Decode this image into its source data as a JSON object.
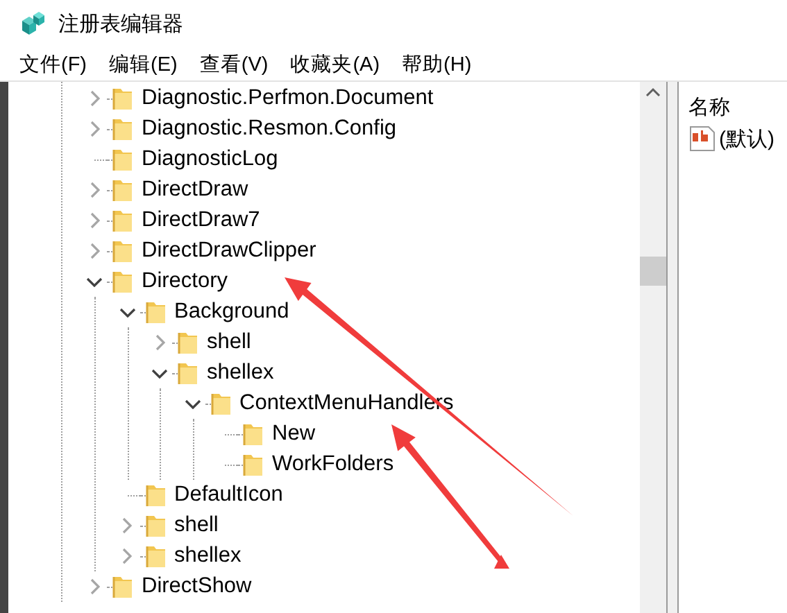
{
  "window": {
    "title": "注册表编辑器"
  },
  "menu": [
    "文件(F)",
    "编辑(E)",
    "查看(V)",
    "收藏夹(A)",
    "帮助(H)"
  ],
  "tree": [
    {
      "label": "Diagnostic.Perfmon.Document",
      "expandable": true,
      "expanded": false
    },
    {
      "label": "Diagnostic.Resmon.Config",
      "expandable": true,
      "expanded": false
    },
    {
      "label": "DiagnosticLog",
      "expandable": false
    },
    {
      "label": "DirectDraw",
      "expandable": true,
      "expanded": false
    },
    {
      "label": "DirectDraw7",
      "expandable": true,
      "expanded": false
    },
    {
      "label": "DirectDrawClipper",
      "expandable": true,
      "expanded": false
    },
    {
      "label": "Directory",
      "expandable": true,
      "expanded": true,
      "children": [
        {
          "label": "Background",
          "expandable": true,
          "expanded": true,
          "children": [
            {
              "label": "shell",
              "expandable": true,
              "expanded": false
            },
            {
              "label": "shellex",
              "expandable": true,
              "expanded": true,
              "children": [
                {
                  "label": "ContextMenuHandlers",
                  "expandable": true,
                  "expanded": true,
                  "children": [
                    {
                      "label": "New",
                      "expandable": false
                    },
                    {
                      "label": "WorkFolders",
                      "expandable": false
                    }
                  ]
                }
              ]
            }
          ]
        },
        {
          "label": "DefaultIcon",
          "expandable": false
        },
        {
          "label": "shell",
          "expandable": true,
          "expanded": false
        },
        {
          "label": "shellex",
          "expandable": true,
          "expanded": false
        }
      ]
    },
    {
      "label": "DirectShow",
      "expandable": true,
      "expanded": false
    }
  ],
  "list": {
    "columns": [
      "名称"
    ],
    "rows": [
      {
        "name": "(默认)"
      }
    ]
  }
}
